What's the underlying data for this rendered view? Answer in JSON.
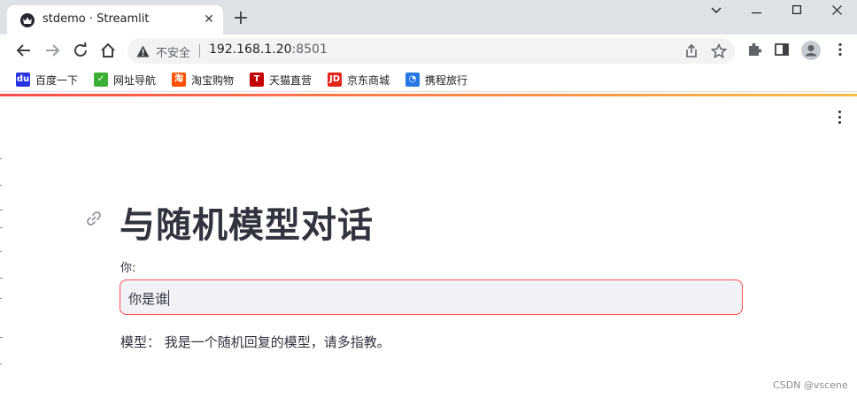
{
  "browser": {
    "tab": {
      "title": "stdemo · Streamlit"
    },
    "window_controls": {
      "chevron": "⌄",
      "minimize": "—",
      "maximize": "☐",
      "close": "✕"
    },
    "address": {
      "security_label": "不安全",
      "host": "192.168.1.20",
      "port": ":8501"
    },
    "bookmarks": [
      {
        "label": "百度一下",
        "icon": "baidu-icon",
        "color": "#2932e1"
      },
      {
        "label": "网址导航",
        "icon": "hao-icon",
        "color": "#3cb034"
      },
      {
        "label": "淘宝购物",
        "icon": "taobao-icon",
        "color": "#ff5000"
      },
      {
        "label": "天猫直营",
        "icon": "tmall-icon",
        "color": "#c40000"
      },
      {
        "label": "京东商城",
        "icon": "jd-icon",
        "color": "#e1251b"
      },
      {
        "label": "携程旅行",
        "icon": "ctrip-icon",
        "color": "#2577e3"
      }
    ]
  },
  "app": {
    "title": "与随机模型对话",
    "input": {
      "label": "你:",
      "value": "你是谁"
    },
    "reply": "模型： 我是一个随机回复的模型，请多指教。",
    "accent_color": "#ff4b4b"
  },
  "watermark": "CSDN @vscene"
}
